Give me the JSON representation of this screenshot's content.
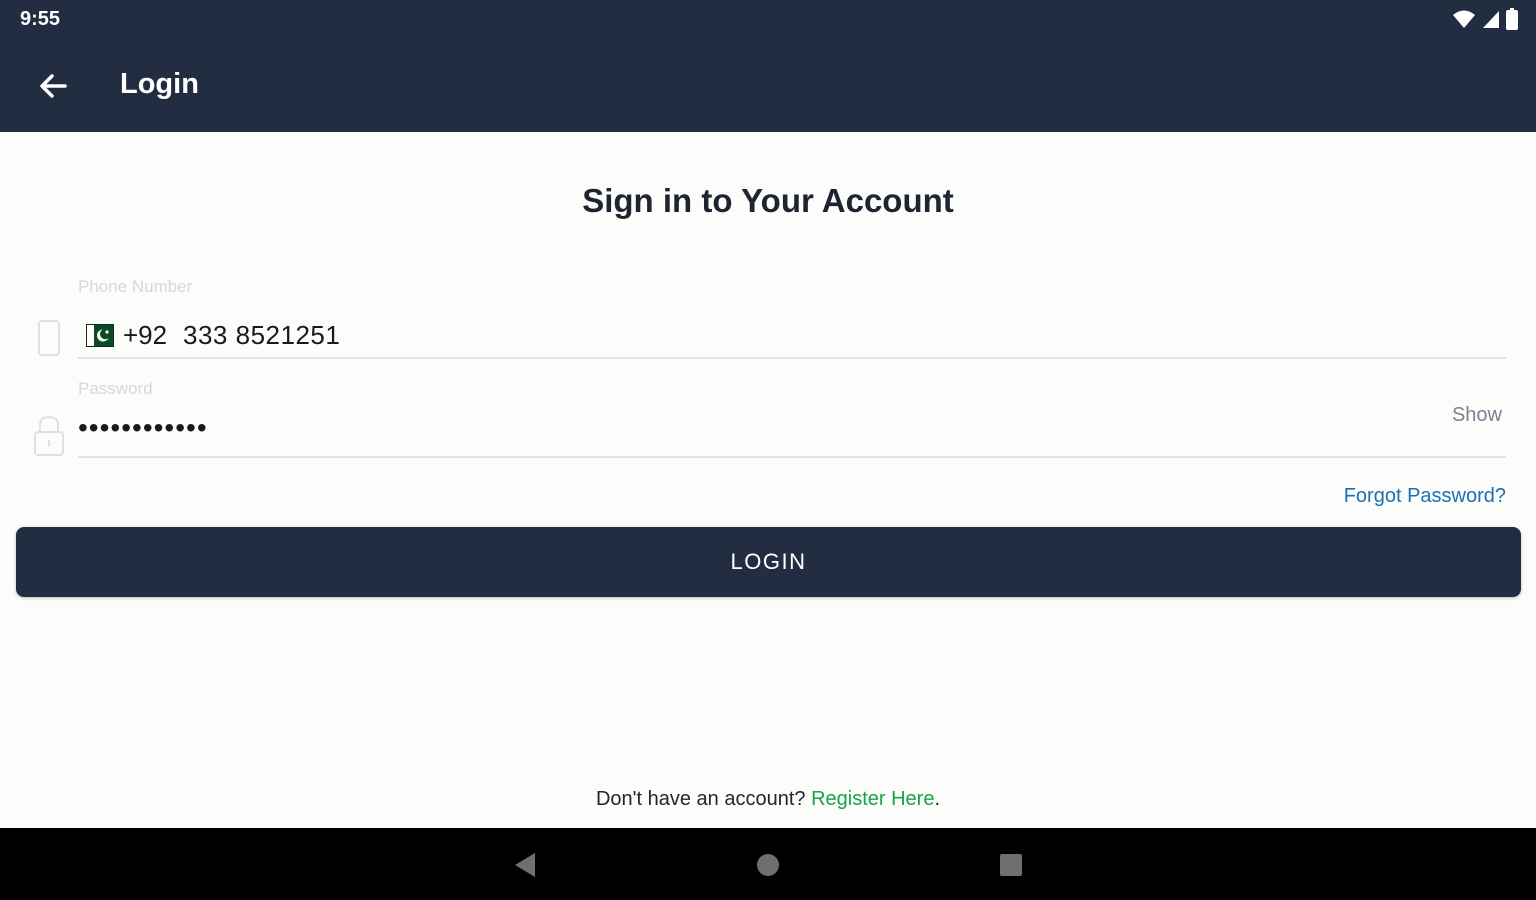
{
  "status_bar": {
    "time": "9:55",
    "icons": [
      "wifi-icon",
      "signal-icon",
      "battery-icon"
    ]
  },
  "app_bar": {
    "title": "Login",
    "back_icon": "arrow-left-icon"
  },
  "heading": "Sign in to Your Account",
  "phone_field": {
    "label": "Phone Number",
    "icon": "phone-icon",
    "country_flag": "pakistan-flag-icon",
    "dial_code": "+92",
    "value": "333 8521251"
  },
  "password_field": {
    "label": "Password",
    "icon": "lock-icon",
    "value": "••••••••••••",
    "toggle_label": "Show"
  },
  "forgot_password_label": "Forgot Password?",
  "login_button_label": "LOGIN",
  "register": {
    "prompt": "Don't have an account? ",
    "link_label": "Register Here",
    "suffix": "."
  },
  "nav_bar": {
    "back": "nav-back-icon",
    "home": "nav-home-icon",
    "recents": "nav-recents-icon"
  },
  "colors": {
    "primary": "#222d42",
    "link": "#1b6fb4",
    "register_link": "#1aa34a",
    "background": "#fcfcfb"
  }
}
